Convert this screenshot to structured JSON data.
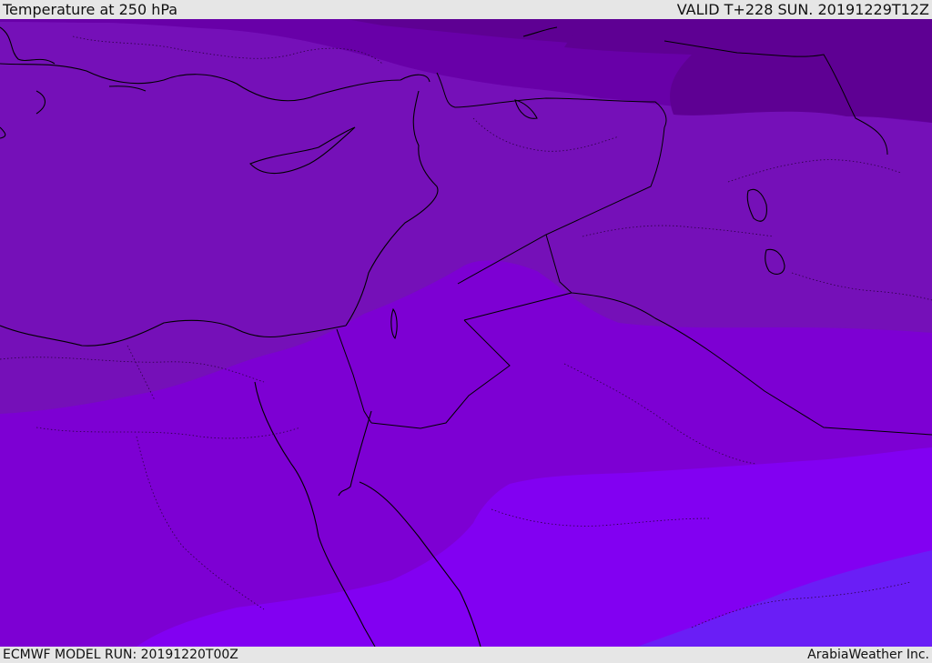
{
  "header": {
    "title": "Temperature at 250 hPa",
    "valid": "VALID T+228 SUN. 20191229T12Z"
  },
  "footer": {
    "model_run": "ECMWF MODEL RUN: 20191220T00Z",
    "credit": "ArabiaWeather Inc."
  },
  "colors": {
    "band_1": "#5e0093",
    "band_2": "#6800a8",
    "band_3": "#7510b8",
    "band_4": "#7d00d3",
    "band_5": "#8200f2",
    "band_6": "#6a1ef6",
    "borders": "#000000"
  }
}
